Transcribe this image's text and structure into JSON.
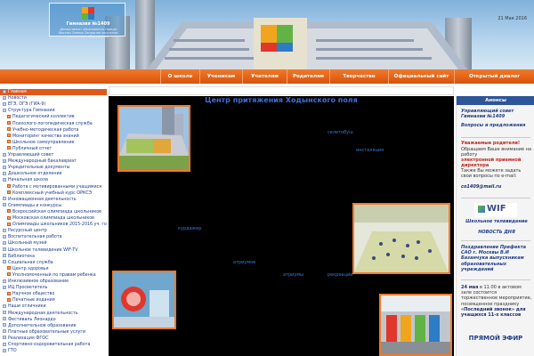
{
  "header": {
    "logo_title": "Гимназия №1409",
    "logo_subtitle": "Департамент образования города Москвы Северо-Западное окружное управление образования",
    "date": "21 Мая 2016"
  },
  "nav": [
    "О школе",
    "Ученикам",
    "Учителям",
    "Родителям",
    "Творчество",
    "Официальный сайт",
    "Открытый диалог"
  ],
  "sidebar": [
    {
      "label": "Главная",
      "sub": false,
      "active": true
    },
    {
      "label": "Новости",
      "sub": false
    },
    {
      "label": "ЕГЭ, ОГЭ (ГИА-9)",
      "sub": false
    },
    {
      "label": "Структура Гимназии",
      "sub": false
    },
    {
      "label": "Педагогический коллектив",
      "sub": true
    },
    {
      "label": "Психолого-логопедическая служба",
      "sub": true
    },
    {
      "label": "Учебно-методическая работа",
      "sub": true
    },
    {
      "label": "Мониторинг качества знаний",
      "sub": true
    },
    {
      "label": "Школьное самоуправление",
      "sub": true
    },
    {
      "label": "Публичный отчет",
      "sub": true
    },
    {
      "label": "Управляющий совет",
      "sub": false
    },
    {
      "label": "Международный бакалавриат",
      "sub": false
    },
    {
      "label": "Учредительные документы",
      "sub": false
    },
    {
      "label": "Дошкольное отделение",
      "sub": false
    },
    {
      "label": "Начальная школа",
      "sub": false
    },
    {
      "label": "Работа с мотивированными учащимися",
      "sub": true
    },
    {
      "label": "Комплексный учебный курс ОРКСЭ",
      "sub": true
    },
    {
      "label": "Инновационная деятельность",
      "sub": false
    },
    {
      "label": "Олимпиады и конкурсы",
      "sub": false
    },
    {
      "label": "Всероссийская олимпиада школьников",
      "sub": true
    },
    {
      "label": "Московская олимпиада школьников",
      "sub": true
    },
    {
      "label": "Олимпиады школьников 2015-2016 уч. год",
      "sub": true
    },
    {
      "label": "Ресурсный центр",
      "sub": false
    },
    {
      "label": "Воспитательная работа",
      "sub": false
    },
    {
      "label": "Школьный музей",
      "sub": false
    },
    {
      "label": "Школьное телевидение WIF-TV",
      "sub": false
    },
    {
      "label": "Библиотека",
      "sub": false
    },
    {
      "label": "Социальная служба",
      "sub": false
    },
    {
      "label": "Центр здоровья",
      "sub": true
    },
    {
      "label": "Уполномоченный по правам ребенка",
      "sub": true
    },
    {
      "label": "Инклюзивное образование",
      "sub": false
    },
    {
      "label": "ИЦ Просветитель",
      "sub": false
    },
    {
      "label": "Научное общество",
      "sub": true
    },
    {
      "label": "Печатные издания",
      "sub": true
    },
    {
      "label": "Наши отличники",
      "sub": false
    },
    {
      "label": "Международная деятельность",
      "sub": false
    },
    {
      "label": "Фестиваль Леонардо",
      "sub": false
    },
    {
      "label": "Дополнительное образование",
      "sub": false
    },
    {
      "label": "Платные образовательные услуги",
      "sub": false
    },
    {
      "label": "Реализация ФГОС",
      "sub": false
    },
    {
      "label": "Спортивно-оздоровительная работа",
      "sub": false
    },
    {
      "label": "ГТО",
      "sub": false
    }
  ],
  "main": {
    "title": "Центр притяжения Ходынского поля",
    "hotspots": [
      "селетобуш",
      "инсталяция",
      "курдажер",
      "атриумов",
      "атриумы",
      "рекреации"
    ]
  },
  "right": {
    "head": "Анонсы",
    "council": "Управляющий совет Гимназии №1409",
    "qa": "Вопросы и предложения",
    "parents_title": "Уважаемые родители!",
    "parents_text_1": "Обращаем Ваше внимание на работу",
    "parents_link": "электронной приемной директора",
    "parents_text_2": "Также Вы можете задать свои вопросы по e-mail:",
    "email": "co1409@mail.ru",
    "wif_title": "Школьное телевидение",
    "wif_logo": "WIF",
    "video_news": "НОВОСТЬ ДНЯ",
    "congrats": "Поздравление Префекта САО г. Москвы В.И Базанчука выпускникам образовательных учреждений",
    "event_date": "24 мая",
    "event_text": "в 11.00 в актовом зале состоится торжественное мероприятие, посвященное празднику",
    "event_name": "«Последний звонок»",
    "event_tail": "для учащихся 11-х классов",
    "live": "ПРЯМОЙ ЭФИР"
  }
}
